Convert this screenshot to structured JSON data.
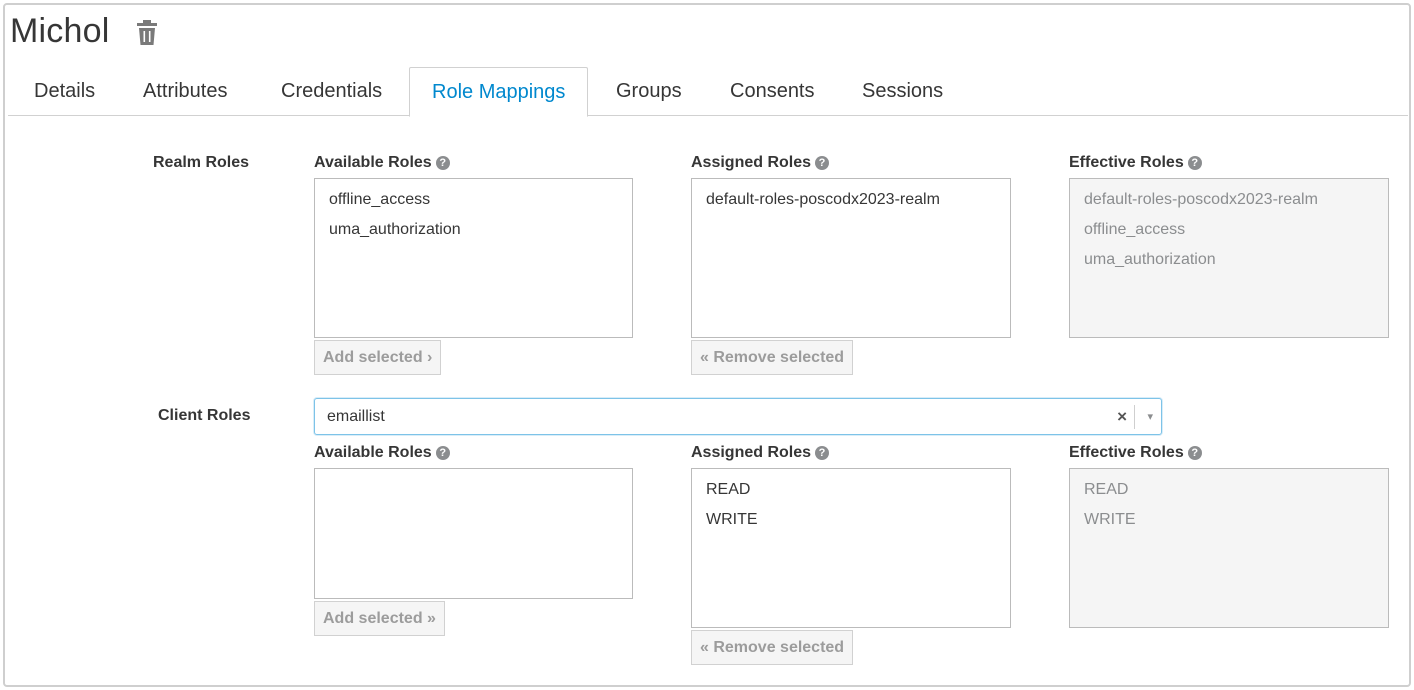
{
  "header": {
    "user_name": "Michol"
  },
  "tabs": [
    {
      "label": "Details"
    },
    {
      "label": "Attributes"
    },
    {
      "label": "Credentials"
    },
    {
      "label": "Role Mappings",
      "active": true
    },
    {
      "label": "Groups"
    },
    {
      "label": "Consents"
    },
    {
      "label": "Sessions"
    }
  ],
  "realm_roles": {
    "label": "Realm Roles",
    "available": {
      "label": "Available Roles",
      "items": [
        "offline_access",
        "uma_authorization"
      ]
    },
    "assigned": {
      "label": "Assigned Roles",
      "items": [
        "default-roles-poscodx2023-realm"
      ]
    },
    "effective": {
      "label": "Effective Roles",
      "items": [
        "default-roles-poscodx2023-realm",
        "offline_access",
        "uma_authorization"
      ]
    },
    "add_button": "Add selected ›",
    "remove_button": "« Remove selected"
  },
  "client_roles": {
    "label": "Client Roles",
    "client_select": {
      "value": "emaillist",
      "clear": "×",
      "arrow": "▾"
    },
    "available": {
      "label": "Available Roles",
      "items": []
    },
    "assigned": {
      "label": "Assigned Roles",
      "items": [
        "READ",
        "WRITE"
      ]
    },
    "effective": {
      "label": "Effective Roles",
      "items": [
        "READ",
        "WRITE"
      ]
    },
    "add_button": "Add selected »",
    "remove_button": "« Remove selected"
  },
  "icons": {
    "help": "?",
    "trash": "trash-icon"
  },
  "colors": {
    "accent": "#0088ce",
    "text": "#363636",
    "muted": "#8b8d8f"
  }
}
